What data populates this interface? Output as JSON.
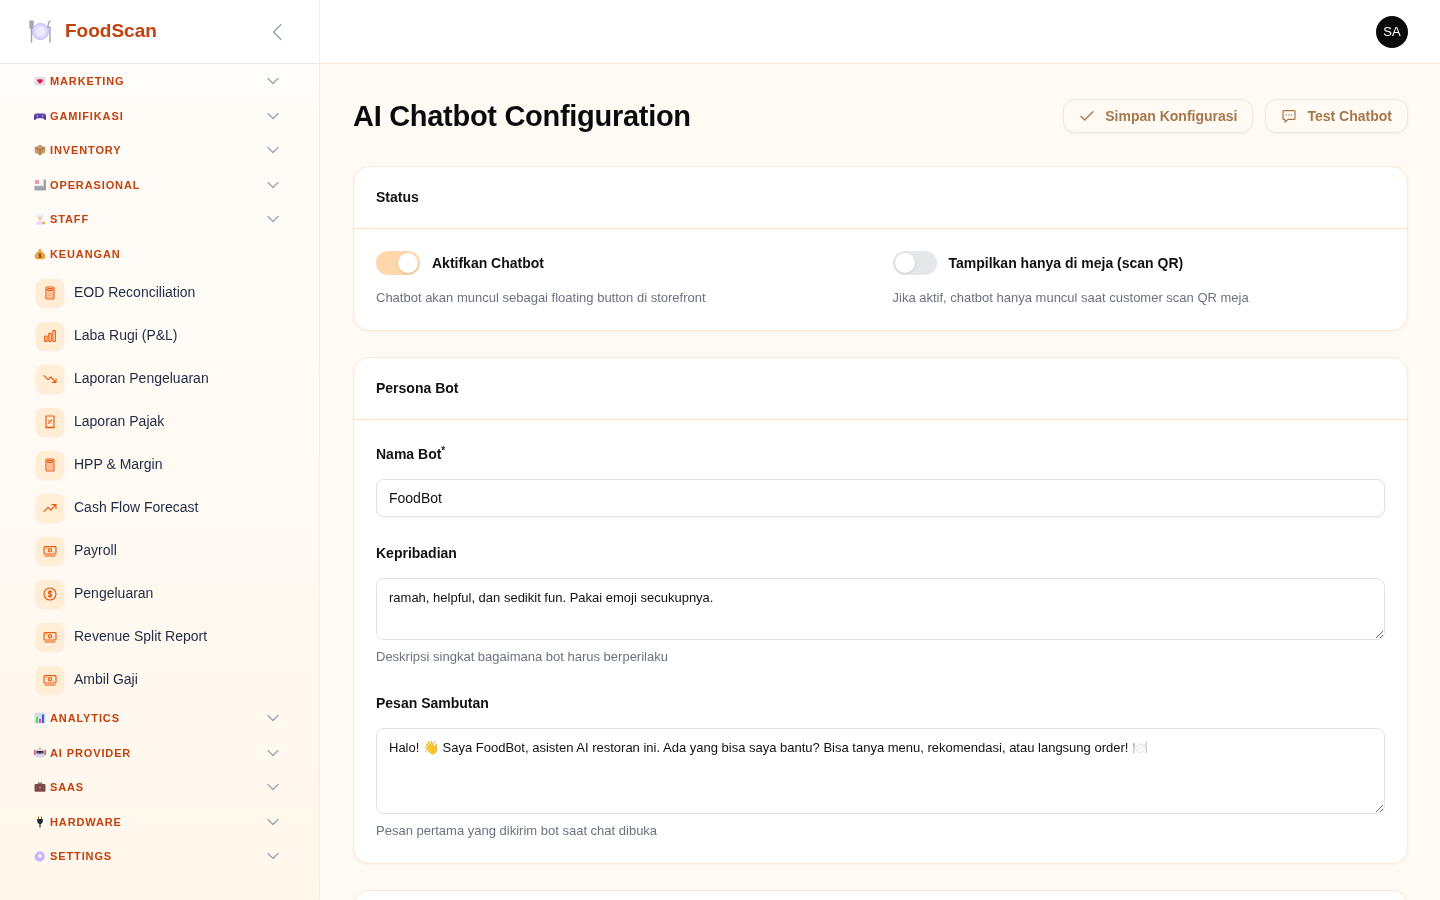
{
  "sidebar": {
    "brand": "FoodScan",
    "groups": [
      {
        "label": "MARKETING",
        "expanded": false
      },
      {
        "label": "GAMIFIKASI",
        "expanded": false
      },
      {
        "label": "INVENTORY",
        "expanded": false
      },
      {
        "label": "OPERASIONAL",
        "expanded": false
      },
      {
        "label": "STAFF",
        "expanded": false
      },
      {
        "label": "KEUANGAN",
        "expanded": true,
        "children": [
          {
            "label": "EOD Reconciliation",
            "selected": false
          },
          {
            "label": "Laba Rugi (P&L)",
            "selected": false
          },
          {
            "label": "Laporan Pengeluaran",
            "selected": false
          },
          {
            "label": "Laporan Pajak",
            "selected": false
          },
          {
            "label": "HPP & Margin",
            "selected": false
          },
          {
            "label": "Cash Flow Forecast",
            "selected": false
          },
          {
            "label": "Payroll",
            "selected": false
          },
          {
            "label": "Pengeluaran",
            "selected": false
          },
          {
            "label": "Revenue Split Report",
            "selected": false
          },
          {
            "label": "Ambil Gaji",
            "selected": false
          }
        ]
      },
      {
        "label": "ANALYTICS",
        "expanded": false
      },
      {
        "label": "AI PROVIDER",
        "expanded": false
      },
      {
        "label": "SAAS",
        "expanded": false
      },
      {
        "label": "HARDWARE",
        "expanded": false
      },
      {
        "label": "SETTINGS",
        "expanded": false
      }
    ]
  },
  "header": {
    "avatar": "SA"
  },
  "page": {
    "title": "AI Chatbot Configuration",
    "buttons": [
      {
        "label": "Simpan Konfigurasi"
      },
      {
        "label": "Test Chatbot"
      }
    ]
  },
  "status_card": {
    "title": "Status",
    "toggles": [
      {
        "label": "Aktifkan Chatbot",
        "hint": "Chatbot akan muncul sebagai floating button di storefront",
        "on": true
      },
      {
        "label": "Tampilkan hanya di meja (scan QR)",
        "hint": "Jika aktif, chatbot hanya muncul saat customer scan QR meja",
        "on": false
      }
    ]
  },
  "persona_card": {
    "title": "Persona Bot",
    "fields": [
      {
        "kind": "input",
        "label": "Nama Bot$^{*}$",
        "value": "FoodBot"
      },
      {
        "kind": "textarea",
        "label": "Kepribadian",
        "value": "ramah, helpful, dan sedikit fun. Pakai emoji secukupnya.",
        "hint": "Deskripsi singkat bagaimana bot harus berperilaku"
      },
      {
        "kind": "textarea",
        "label": "Pesan Sambutan",
        "value": "Halo! 👋 Saya FoodBot, asisten AI restoran ini. Ada yang bisa saya bantu? Bisa tanya menu, rekomendasi, atau langsung order! 🍽️",
        "hint": "Pesan pertama yang dikirim bot saat chat dibuka"
      }
    ]
  }
}
